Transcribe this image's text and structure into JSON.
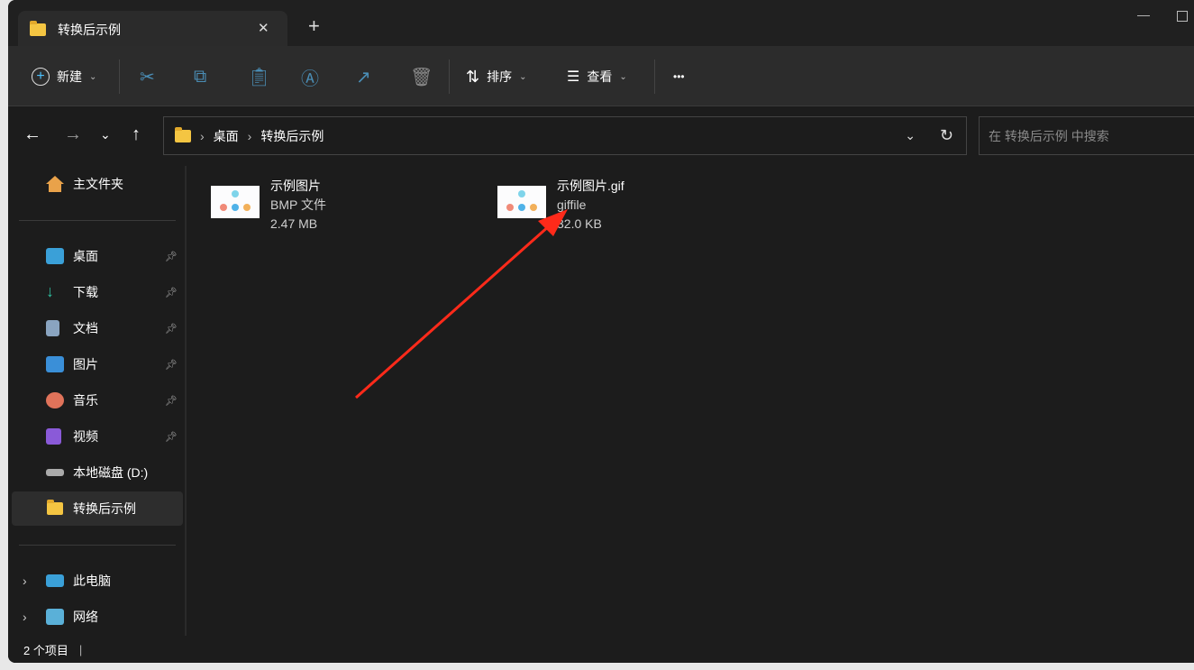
{
  "window": {
    "tab_title": "转换后示例",
    "new_tab": "+",
    "close_tab": "✕",
    "minimize": "—"
  },
  "toolbar": {
    "new_label": "新建",
    "sort_label": "排序",
    "view_label": "查看",
    "more": "•••"
  },
  "address": {
    "breadcrumb": [
      "桌面",
      "转换后示例"
    ],
    "search_placeholder": "在 转换后示例 中搜索"
  },
  "sidebar": {
    "home": "主文件夹",
    "items": [
      {
        "label": "桌面",
        "icon": "desktop-icon",
        "color": "#3aa0d8"
      },
      {
        "label": "下载",
        "icon": "download-icon",
        "color": "#2fbf9f"
      },
      {
        "label": "文档",
        "icon": "document-icon",
        "color": "#8aa4c0"
      },
      {
        "label": "图片",
        "icon": "pictures-icon",
        "color": "#3a8fd8"
      },
      {
        "label": "音乐",
        "icon": "music-icon",
        "color": "#e0735a"
      },
      {
        "label": "视频",
        "icon": "video-icon",
        "color": "#8a5ad8"
      },
      {
        "label": "本地磁盘 (D:)",
        "icon": "drive-icon",
        "color": "#aaaaaa"
      },
      {
        "label": "转换后示例",
        "icon": "folder-icon",
        "color": "#f4c542"
      }
    ],
    "this_pc": "此电脑",
    "network": "网络"
  },
  "files": [
    {
      "name": "示例图片",
      "type": "BMP 文件",
      "size": "2.47 MB"
    },
    {
      "name": "示例图片.gif",
      "type": "giffile",
      "size": "32.0 KB"
    }
  ],
  "status": {
    "count": "2 个项目"
  },
  "annotation": {
    "arrow_color": "#ff2a1a"
  }
}
